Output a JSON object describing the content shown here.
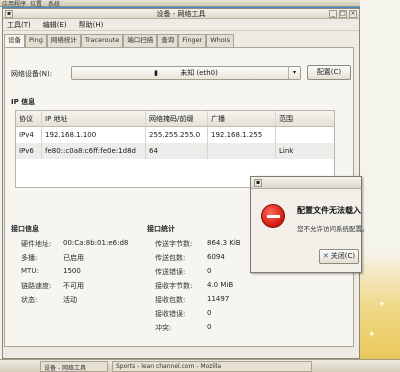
{
  "desktop": {
    "top_panel": [
      "应用程序",
      "位置",
      "系统"
    ],
    "taskbar": [
      {
        "label": "设备 - 网络工具"
      },
      {
        "label": "Sports - lean channel.com - Mozilla"
      }
    ]
  },
  "window": {
    "title": "设备 - 网络工具",
    "controls": {
      "minimize": "_",
      "maximize": "□",
      "close": "×"
    }
  },
  "menu": [
    "工具(T)",
    "编辑(E)",
    "帮助(H)"
  ],
  "tabs": [
    {
      "label": "设备",
      "active": true
    },
    {
      "label": "Ping",
      "active": false
    },
    {
      "label": "网络统计",
      "active": false
    },
    {
      "label": "Traceroute",
      "active": false
    },
    {
      "label": "端口扫描",
      "active": false
    },
    {
      "label": "查询",
      "active": false
    },
    {
      "label": "Finger",
      "active": false
    },
    {
      "label": "Whois",
      "active": false
    }
  ],
  "device": {
    "label": "网络设备(N):",
    "selected": "未知 (eth0)",
    "configure_button": "配置(C)"
  },
  "ip_info": {
    "heading": "IP 信息",
    "columns": [
      "协议",
      "IP 地址",
      "网络掩码/前缀",
      "广播",
      "范围"
    ],
    "rows": [
      [
        "IPv4",
        "192.168.1.100",
        "255.255.255.0",
        "192.168.1.255",
        ""
      ],
      [
        "IPv6",
        "fe80::c0a8:c6ff:fe0e:1d8d",
        "64",
        "",
        "Link"
      ]
    ]
  },
  "interface_info": {
    "heading": "接口信息",
    "items": [
      {
        "label": "硬件地址:",
        "value": "00:Ca:8b:01:e6:d8"
      },
      {
        "label": "多播:",
        "value": "已启用"
      },
      {
        "label": "MTU:",
        "value": "1500"
      },
      {
        "label": "链路速度:",
        "value": "不可用"
      },
      {
        "label": "状态:",
        "value": "活动"
      }
    ]
  },
  "interface_stats": {
    "heading": "接口统计",
    "items": [
      {
        "label": "传送字节数:",
        "value": "864.3 KiB"
      },
      {
        "label": "传送包数:",
        "value": "6094"
      },
      {
        "label": "传送错误:",
        "value": "0"
      },
      {
        "label": "接收字节数:",
        "value": "4.0 MiB"
      },
      {
        "label": "接收包数:",
        "value": "11497"
      },
      {
        "label": "接收错误:",
        "value": "0"
      },
      {
        "label": "冲突:",
        "value": "0"
      }
    ]
  },
  "dialog": {
    "message": "配置文件无法载入",
    "detail": "您不允许访问系统配置。",
    "close_button": "关闭(C)"
  }
}
